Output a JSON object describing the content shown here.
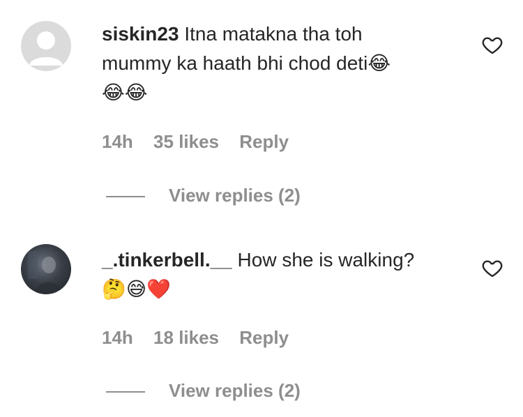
{
  "comments": [
    {
      "username": "siskin23",
      "text_line1": "Itna matakna tha toh",
      "text_line2": "mummy ka haath bhi chod deti",
      "emoji_inline": "😂",
      "emoji_line": "😂😂",
      "time": "14h",
      "likes": "35 likes",
      "reply": "Reply",
      "view_replies": "View replies (2)"
    },
    {
      "username": "_.tinkerbell.__",
      "text_line1": "How she is walking?",
      "emoji_line": "🤔😅❤️",
      "time": "14h",
      "likes": "18 likes",
      "reply": "Reply",
      "view_replies": "View replies (2)"
    }
  ],
  "icons": {
    "like": "heart-outline-icon",
    "avatar_default": "default-avatar-icon"
  }
}
